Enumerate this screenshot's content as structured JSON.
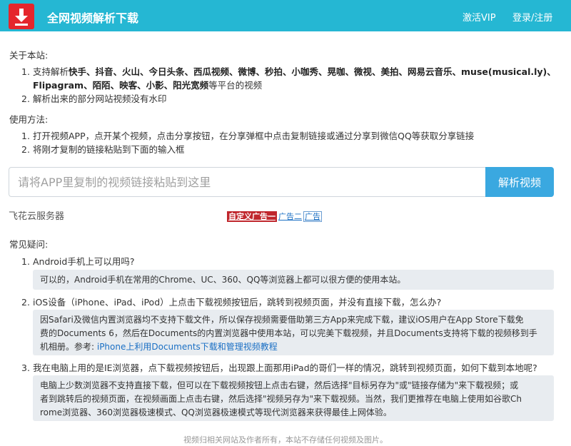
{
  "header": {
    "site_name": "全网视频解析下载",
    "vip": "激活VIP",
    "login": "登录/注册",
    "logo_icon": "download-icon",
    "colors": {
      "bar": "#25b7d3",
      "logo": "#e5262c"
    }
  },
  "about": {
    "title": "关于本站:",
    "item1_prefix": "支持解析",
    "item1_bold": "快手、抖音、火山、今日头条、西瓜视频、微博、秒拍、小咖秀、晃咖、微视、美拍、网易云音乐、muse(musical.ly)、",
    "item1_bold2": "Flipagram、陌陌、映客、小影、阳光宽频",
    "item1_suffix": "等平台的视频",
    "item2": "解析出来的部分网站视频没有水印"
  },
  "usage": {
    "title": "使用方法:",
    "step1": "打开视频APP，点开某个视频，点击分享按钮，在分享弹框中点击复制链接或通过分享到微信QQ等获取分享链接",
    "step2": "将刚才复制的链接粘贴到下面的输入框"
  },
  "search": {
    "placeholder": "请将APP里复制的视频链接粘贴到这里",
    "button": "解析视频"
  },
  "server": "飞花云服务器",
  "ads": {
    "ad1": "自定义广告一",
    "ad2": "广告二",
    "ad3": "广告"
  },
  "faq": {
    "title": "常见疑问:",
    "q1": "Android手机上可以用吗?",
    "a1": "可以的，Android手机在常用的Chrome、UC、360、QQ等浏览器上都可以很方便的使用本站。",
    "q2": "iOS设备（iPhone、iPad、iPod）上点击下载视频按钮后，跳转到视频页面，并没有直接下载，怎么办?",
    "a2_line1": "因Safari及微信内置浏览器均不支持下载文件，所以保存视频需要借助第三方App来完成下载，建议iOS用户在App Store下载免",
    "a2_line2": "费的Documents 6，然后在Documents的内置浏览器中使用本站，可以完美下载视频，并且Documents支持将下载的视频移到手",
    "a2_line3": "机相册。参考: ",
    "a2_link": "iPhone上利用Documents下载和管理视频教程",
    "q3": "我在电脑上用的是IE浏览器，点下载视频按钮后，出现跟上面那用iPad的哥们一样的情况，跳转到视频页面，如何下载到本地呢?",
    "a3_line1": "电脑上少数浏览器不支持直接下载，但可以在下载视频按钮上点击右键，然后选择\"目标另存为\"或\"链接存储为\"来下载视频；或",
    "a3_line2": "者到跳转后的视频页面，在视频画面上点击右键，然后选择\"视频另存为\"来下载视频。当然，我们更推荐在电脑上使用如谷歌Ch",
    "a3_line3": "rome浏览器、360浏览器极速模式、QQ浏览器极速模式等现代浏览器来获得最佳上网体验。"
  },
  "footer": "视频归相关网站及作者所有，本站不存储任何视频及图片。"
}
